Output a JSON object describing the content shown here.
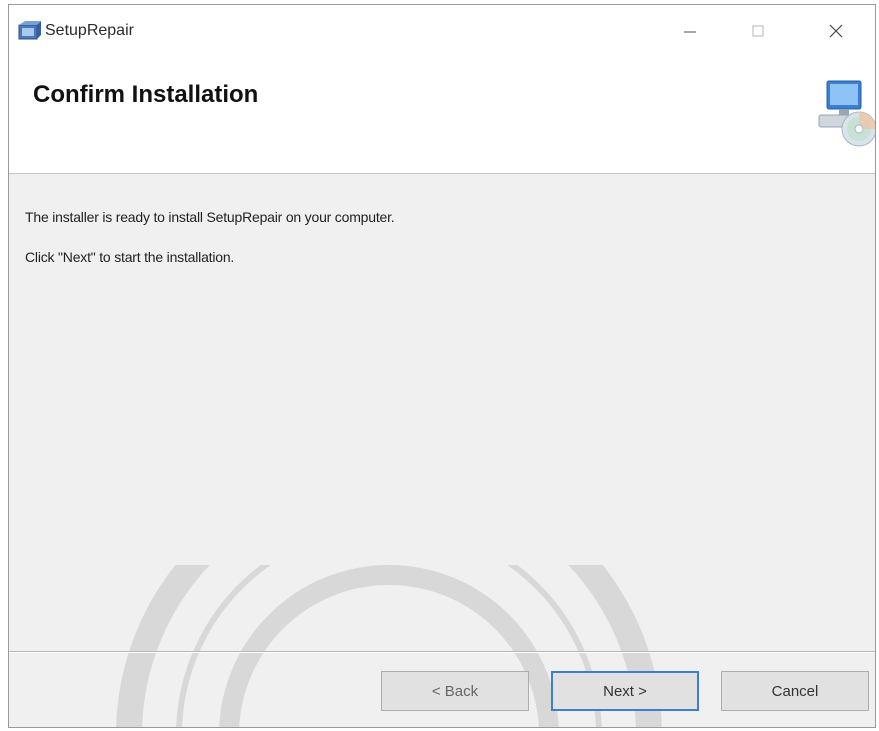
{
  "window": {
    "title": "SetupRepair",
    "icon": "installer-icon",
    "controls": {
      "minimize_icon": "minimize-icon",
      "maximize_icon": "maximize-icon",
      "close_icon": "close-icon"
    }
  },
  "banner": {
    "title": "Confirm Installation",
    "icon": "computer-cd-icon"
  },
  "body": {
    "line1": "The installer is ready to install SetupRepair on your computer.",
    "line2": "Click \"Next\" to start the installation."
  },
  "buttons": {
    "back": "< Back",
    "next": "Next >",
    "cancel": "Cancel"
  },
  "colors": {
    "window_bg": "#f0f0f0",
    "banner_bg": "#ffffff",
    "focus_border": "#3c7fcf"
  }
}
